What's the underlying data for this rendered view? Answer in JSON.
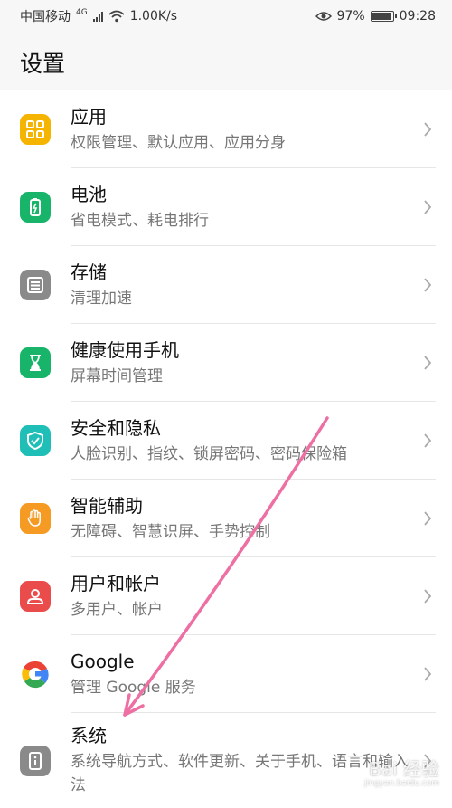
{
  "status_bar": {
    "carrier": "中国移动",
    "network": "4G",
    "speed": "1.00K/s",
    "battery_percent": "97%",
    "battery_level": 0.97,
    "time": "09:28"
  },
  "header": {
    "title": "设置"
  },
  "items": [
    {
      "title": "应用",
      "subtitle": "权限管理、默认应用、应用分身",
      "icon": "apps-icon",
      "color": "#f5b400"
    },
    {
      "title": "电池",
      "subtitle": "省电模式、耗电排行",
      "icon": "battery-icon",
      "color": "#17b46a"
    },
    {
      "title": "存储",
      "subtitle": "清理加速",
      "icon": "storage-icon",
      "color": "#8a8a8a"
    },
    {
      "title": "健康使用手机",
      "subtitle": "屏幕时间管理",
      "icon": "hourglass-icon",
      "color": "#17b46a"
    },
    {
      "title": "安全和隐私",
      "subtitle": "人脸识别、指纹、锁屏密码、密码保险箱",
      "icon": "shield-icon",
      "color": "#1fbfb8"
    },
    {
      "title": "智能辅助",
      "subtitle": "无障碍、智慧识屏、手势控制",
      "icon": "hand-icon",
      "color": "#f59a23"
    },
    {
      "title": "用户和帐户",
      "subtitle": "多用户、帐户",
      "icon": "user-icon",
      "color": "#ea4c4c"
    },
    {
      "title": "Google",
      "subtitle": "管理 Google 服务",
      "icon": "google-icon",
      "color": "#ffffff"
    },
    {
      "title": "系统",
      "subtitle": "系统导航方式、软件更新、关于手机、语言和输入法",
      "icon": "info-icon",
      "color": "#8a8a8a"
    }
  ],
  "annotation": {
    "arrow_color": "#ee6fa3"
  },
  "watermark": {
    "text": "Bai 经验",
    "url": "jingyan.baidu.com"
  }
}
